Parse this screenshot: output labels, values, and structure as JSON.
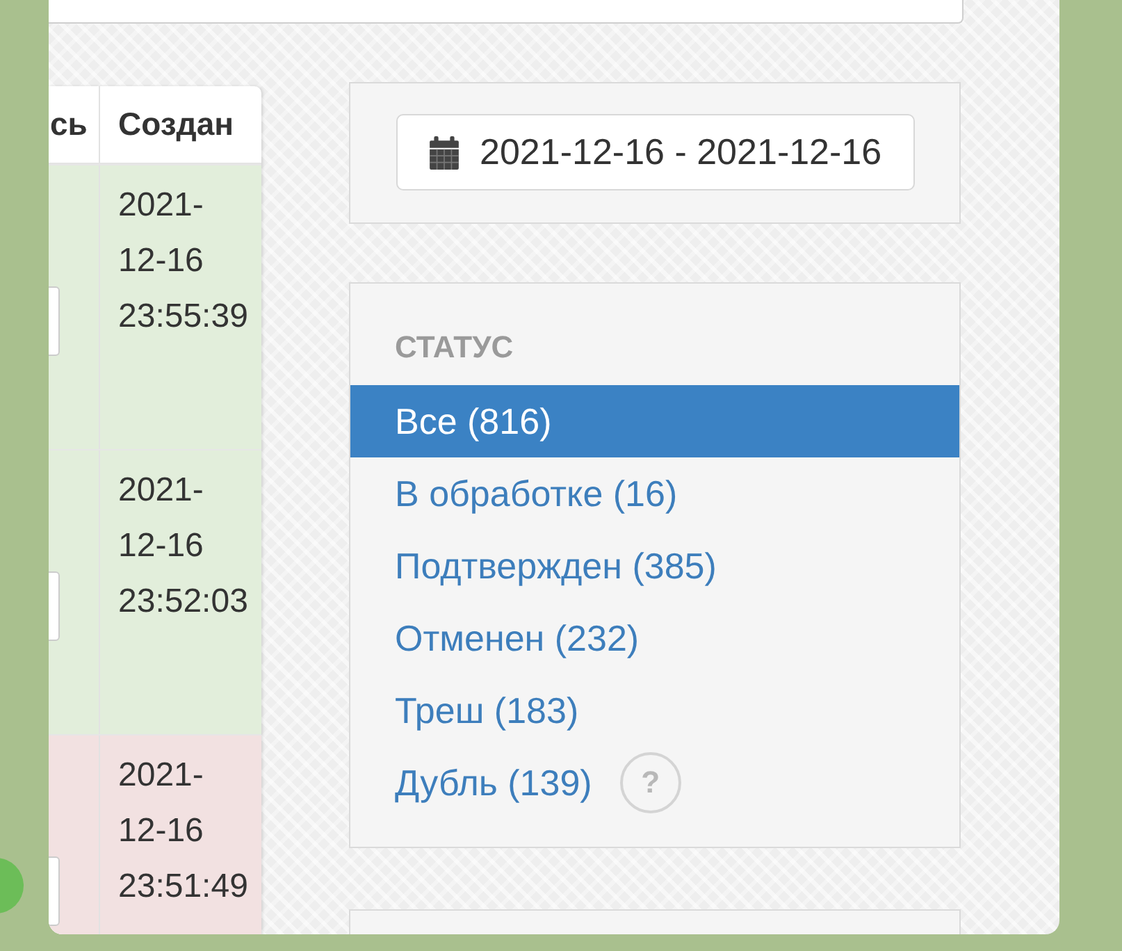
{
  "table": {
    "columns": [
      {
        "label": "сь"
      },
      {
        "label": "Создан"
      }
    ],
    "rows": [
      {
        "color": "#e2eedb",
        "created": "2021-12-16 23:55:39"
      },
      {
        "color": "#e2eedb",
        "created": "2021-12-16 23:52:03"
      },
      {
        "color": "#f2e1e1",
        "created": "2021-12-16 23:51:49"
      }
    ]
  },
  "date_filter": {
    "value": "2021-12-16 - 2021-12-16"
  },
  "status": {
    "heading": "СТАТУС",
    "items": [
      {
        "label": "Все (816)",
        "selected": true
      },
      {
        "label": "В обработке (16)",
        "selected": false
      },
      {
        "label": "Подтвержден (385)",
        "selected": false
      },
      {
        "label": "Отменен (232)",
        "selected": false
      },
      {
        "label": "Треш (183)",
        "selected": false
      },
      {
        "label": "Дубль (139)",
        "selected": false,
        "help": "?"
      }
    ]
  }
}
